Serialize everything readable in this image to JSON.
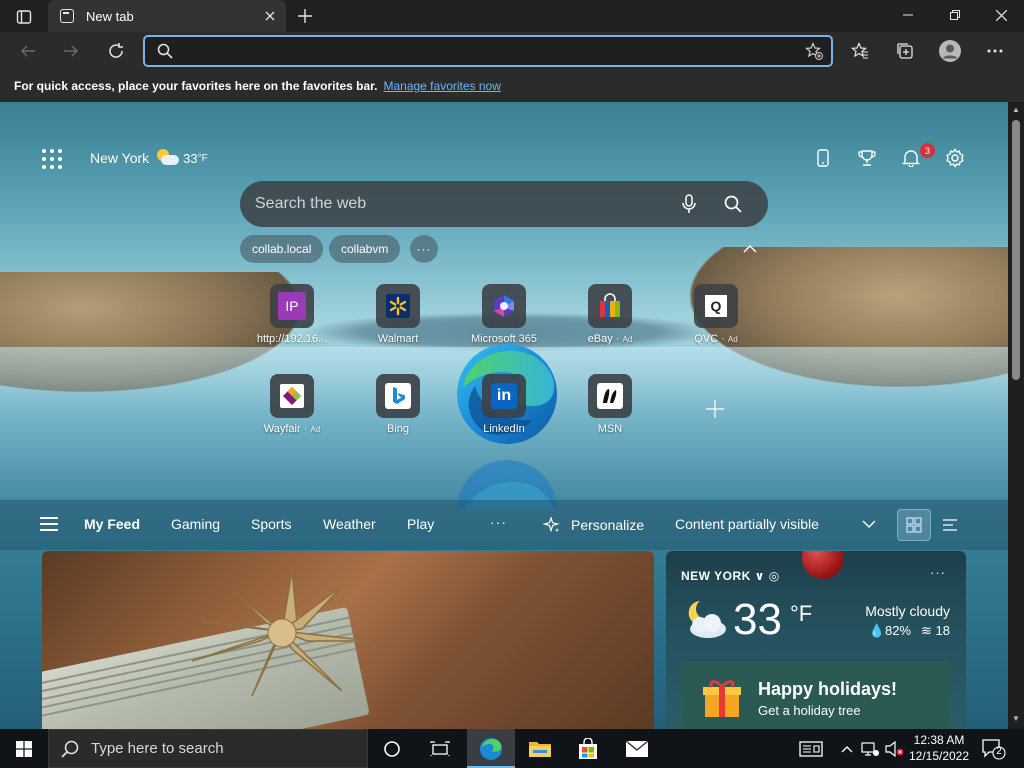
{
  "browser": {
    "tab_title": "New tab",
    "address_value": "",
    "favorites_hint": "For quick access, place your favorites here on the favorites bar.",
    "favorites_link": "Manage favorites now"
  },
  "ntp": {
    "weather_city": "New York",
    "weather_temp": "33",
    "weather_unit": "°F",
    "notification_count": "3",
    "search_placeholder": "Search the web",
    "pills": [
      "collab.local",
      "collabvm"
    ],
    "pill_more": "···",
    "tiles_row1": [
      {
        "label": "http://192.16...",
        "ad": "",
        "icon": "ip-icon"
      },
      {
        "label": "Walmart",
        "ad": "",
        "icon": "walmart-icon"
      },
      {
        "label": "Microsoft 365",
        "ad": "",
        "icon": "microsoft365-icon"
      },
      {
        "label": "eBay",
        "ad": "Ad",
        "icon": "ebay-icon"
      },
      {
        "label": "QVC",
        "ad": "Ad",
        "icon": "qvc-icon"
      }
    ],
    "tiles_row2": [
      {
        "label": "Wayfair",
        "ad": "Ad",
        "icon": "wayfair-icon"
      },
      {
        "label": "Bing",
        "ad": "",
        "icon": "bing-icon"
      },
      {
        "label": "LinkedIn",
        "ad": "",
        "icon": "linkedin-icon"
      },
      {
        "label": "MSN",
        "ad": "",
        "icon": "msn-icon"
      }
    ],
    "ip_tile_text": "IP",
    "linkedin_tile_text": "in",
    "feed_tabs": [
      "My Feed",
      "Gaming",
      "Sports",
      "Weather",
      "Play"
    ],
    "feed_more": "···",
    "personalize": "Personalize",
    "visibility": "Content partially visible"
  },
  "weather_card": {
    "location": "NEW YORK",
    "temp": "33",
    "unit": "°F",
    "condition": "Mostly cloudy",
    "humidity": "82%",
    "wind": "18",
    "more": "···",
    "holiday_title": "Happy holidays!",
    "holiday_sub": "Get a holiday tree"
  },
  "taskbar": {
    "search_placeholder": "Type here to search",
    "time": "12:38 AM",
    "date": "12/15/2022",
    "notification_count": "2"
  },
  "colors": {
    "accent": "#7bb3e8",
    "link": "#6cb6ff",
    "badge": "#d13438"
  }
}
